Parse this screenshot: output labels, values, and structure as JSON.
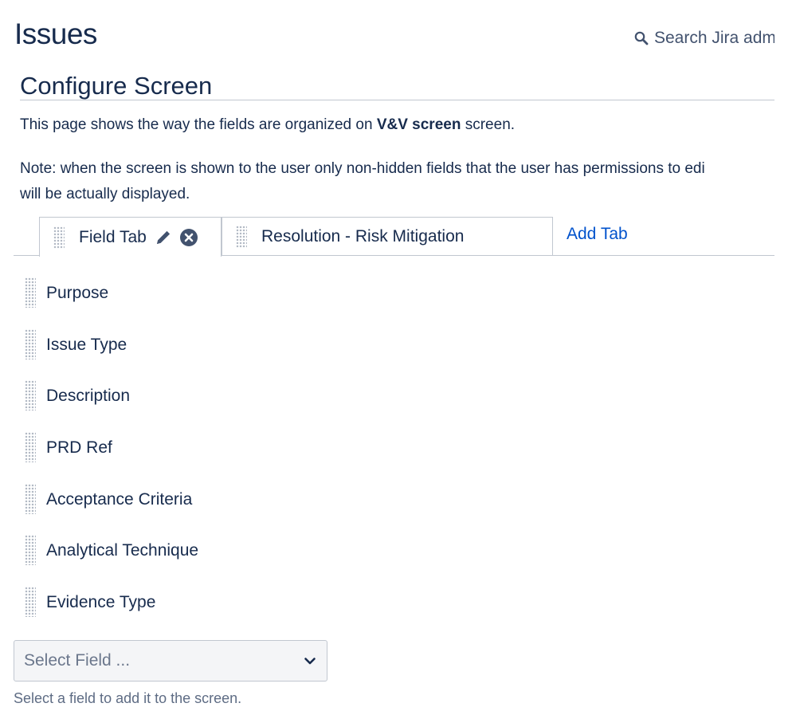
{
  "header": {
    "title": "Issues",
    "search_text": "Search Jira adm",
    "search_icon": "search-icon"
  },
  "section": {
    "title": "Configure Screen",
    "description_prefix": "This page shows the way the fields are organized on ",
    "screen_name": "V&V screen",
    "description_suffix": " screen.",
    "note_line1": "Note: when the screen is shown to the user only non-hidden fields that the user has permissions to edi",
    "note_line2": "will be actually displayed."
  },
  "tabs": {
    "items": [
      {
        "label": "Field Tab",
        "active": true
      },
      {
        "label": "Resolution - Risk Mitigation",
        "active": false
      }
    ],
    "add_label": "Add Tab",
    "edit_icon": "pencil-icon",
    "delete_icon": "close-circle-icon"
  },
  "fields": [
    "Purpose",
    "Issue Type",
    "Description",
    "PRD Ref",
    "Acceptance Criteria",
    "Analytical Technique",
    "Evidence Type"
  ],
  "add_field": {
    "placeholder": "Select Field ...",
    "hint": "Select a field to add it to the screen.",
    "icon": "chevron-down-icon"
  },
  "colors": {
    "text": "#172b4d",
    "link": "#0052cc",
    "border": "#c1c7d0"
  }
}
